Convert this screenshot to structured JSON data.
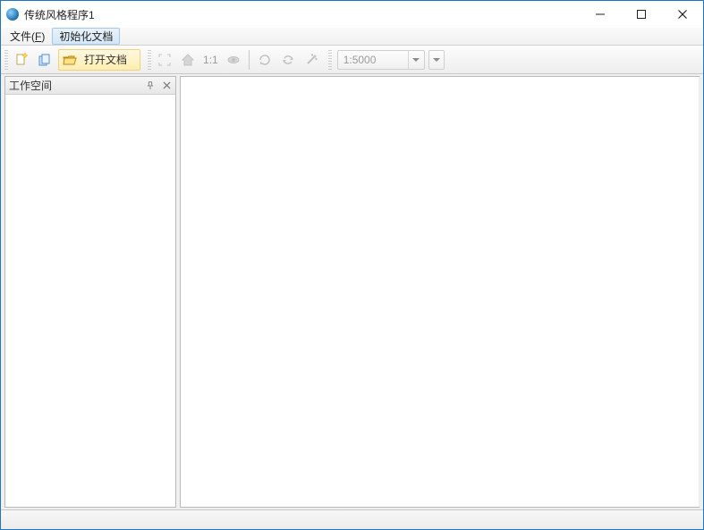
{
  "window": {
    "title": "传统风格程序1"
  },
  "menubar": {
    "file_label": "文件",
    "file_accel": "F",
    "init_doc_label": "初始化文档"
  },
  "toolbar": {
    "open_doc_label": "打开文档",
    "ratio_label": "1:1",
    "scale_value": "1:5000"
  },
  "panels": {
    "workspace_title": "工作空间"
  }
}
